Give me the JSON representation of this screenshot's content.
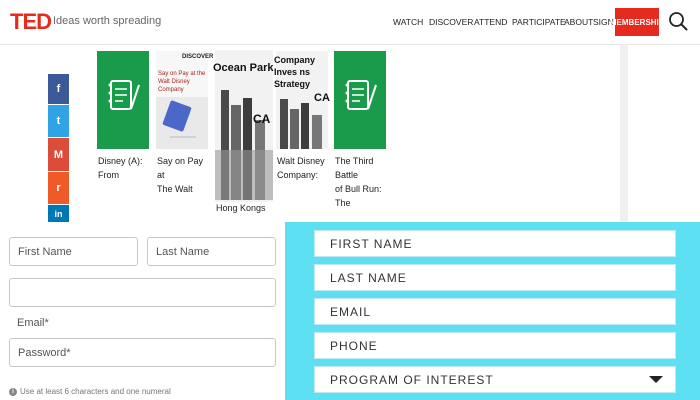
{
  "header": {
    "logo": "TED",
    "tagline": "Ideas worth spreading",
    "nav": [
      "WATCH",
      "DISCOVER",
      "ATTEND",
      "PARTICIPATE",
      "ABOUT",
      "SIGN IN"
    ],
    "membership": "MEMBERSHIP",
    "search_icon": "search-icon"
  },
  "social": [
    {
      "icon": "facebook-icon",
      "glyph": "f",
      "color": "#3b5998"
    },
    {
      "icon": "twitter-icon",
      "glyph": "t",
      "color": "#2ea3e6"
    },
    {
      "icon": "gmail-icon",
      "glyph": "M",
      "color": "#dd4b39"
    },
    {
      "icon": "reddit-icon",
      "glyph": "r",
      "color": "#f05a28"
    },
    {
      "icon": "linkedin-icon",
      "glyph": "in",
      "color": "#0077b5"
    }
  ],
  "cards": [
    {
      "title_line1": "Disney (A):",
      "title_line2": "From",
      "thumb": "notebook-icon",
      "thumb_color": "#1a9b4b"
    },
    {
      "title_line1": "Say on Pay at",
      "title_line2": "The Walt",
      "thumb": "book-cover",
      "cover_top": "DISCOVER",
      "cover_text": "Say on Pay at the Walt Disney Company"
    },
    {
      "title_line1": "Hong Kongs",
      "title_line2": "",
      "thumb": "city-cover",
      "cover_text": "Ocean Park Tal",
      "cover_mark": "CA"
    },
    {
      "title_line1": "Walt Disney",
      "title_line2": "Company:",
      "thumb": "city-cover",
      "cover_text": "Company Inves ns Strategy",
      "cover_mark": "CA"
    },
    {
      "title_line1": "The Third Battle",
      "title_line2": "of Bull Run: The",
      "thumb": "notebook-icon",
      "thumb_color": "#1a9b4b"
    }
  ],
  "left_form": {
    "first_name": "First Name",
    "last_name": "Last Name",
    "email_label": "Email*",
    "password": "Password*",
    "hint": "Use at least 6 characters and one numeral",
    "info_icon": "info-icon"
  },
  "right_form": {
    "bg": "#5ce0f2",
    "fields": [
      "FIRST NAME",
      "LAST NAME",
      "EMAIL",
      "PHONE",
      "PROGRAM OF INTEREST"
    ],
    "dropdown_icon": "caret-down-icon"
  }
}
